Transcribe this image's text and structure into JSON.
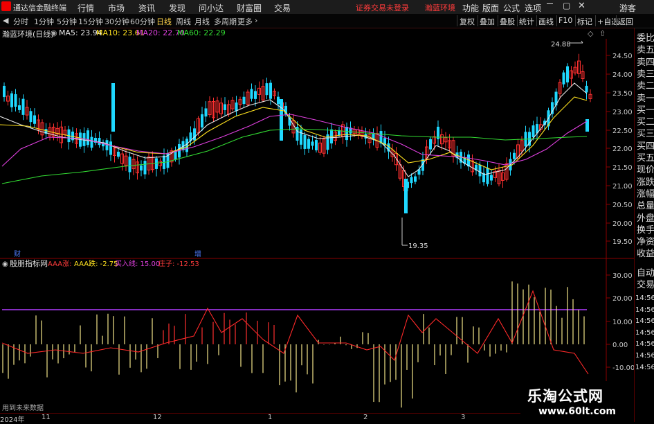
{
  "menubar": {
    "app_title": "通达信金融终端",
    "items": [
      "行情",
      "市场",
      "资讯",
      "发现",
      "问小达",
      "财富圈",
      "交易"
    ],
    "warning": "证券交易未登录",
    "stock_name": "瀚蓝环境",
    "right_items": [
      "功能",
      "版面",
      "公式",
      "选项"
    ],
    "guest": "游客"
  },
  "periodbar": {
    "periods": [
      "分时",
      "1分钟",
      "5分钟",
      "15分钟",
      "30分钟",
      "60分钟",
      "日线",
      "周线",
      "月线",
      "多周期",
      "更多"
    ],
    "active": "日线",
    "tools": [
      "复权",
      "叠加",
      "叠股",
      "统计",
      "画线",
      "F10",
      "标记",
      "+自选",
      "返回"
    ]
  },
  "legend": {
    "title": "瀚蓝环境(日线)",
    "ma": [
      {
        "label": "MA5: 23.94",
        "color": "#e6e6e6"
      },
      {
        "label": "MA10: 23.61",
        "color": "#ffe21f"
      },
      {
        "label": "MA20: 22.70",
        "color": "#e040e0"
      },
      {
        "label": "MA60: 22.29",
        "color": "#33dd33"
      }
    ]
  },
  "price_axis": {
    "ticks": [
      "24.50",
      "24.00",
      "23.50",
      "23.00",
      "22.50",
      "22.00",
      "21.50",
      "21.00",
      "20.50",
      "20.00",
      "19.50"
    ],
    "high_label": "24.88",
    "low_label": "19.35"
  },
  "event_markers": {
    "cai": "财",
    "zeng": "增"
  },
  "indicator": {
    "name": "殷朋指标网",
    "items": [
      {
        "label": "AAA涨:",
        "color": "#ff3b3b"
      },
      {
        "label": "AAA跌: -2.75",
        "color": "#ffe21f"
      },
      {
        "label": "买入线: 15.00",
        "color": "#e040e0"
      },
      {
        "label": "庄子: -12.53",
        "color": "#ff3b3b"
      }
    ],
    "axis": [
      "30.00",
      "20.00",
      "10.00",
      "0.00",
      "-10.00"
    ],
    "future_data_note": "用到未来数据"
  },
  "side_panel": {
    "top": [
      "委比",
      "卖五",
      "卖四",
      "卖三",
      "卖二",
      "卖一",
      "买一",
      "买二",
      "买三",
      "买四",
      "买五",
      "现价",
      "涨跌",
      "涨幅",
      "总量",
      "外盘",
      "换手",
      "净资",
      "收益"
    ],
    "bottom": [
      "自动",
      "交易"
    ],
    "times": [
      "14:56",
      "14:56",
      "14:56",
      "14:56",
      "14:56",
      "14:56",
      "14:56"
    ]
  },
  "time_axis": {
    "labels": [
      "2024年",
      "11",
      "12",
      "1",
      "2",
      "3"
    ]
  },
  "watermark": {
    "title": "乐淘公式网",
    "url": "www.60lt.com"
  }
}
